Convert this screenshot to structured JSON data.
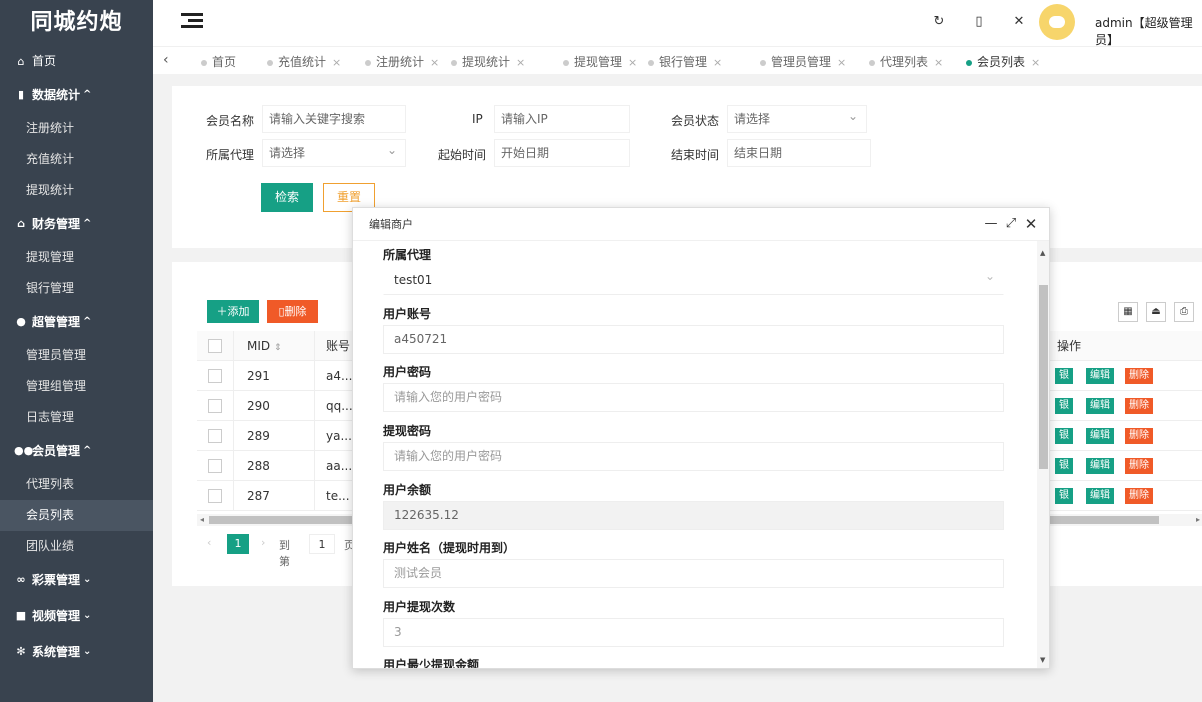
{
  "app": {
    "logo": "同城约炮"
  },
  "sidebar": {
    "home": {
      "label": "首页",
      "icon": "home-icon"
    },
    "groups": [
      {
        "label": "数据统计",
        "icon": "bar-chart-icon",
        "items": [
          "注册统计",
          "充值统计",
          "提现统计"
        ]
      },
      {
        "label": "财务管理",
        "icon": "bank-icon",
        "items": [
          "提现管理",
          "银行管理"
        ]
      },
      {
        "label": "超管管理",
        "icon": "user-icon",
        "items": [
          "管理员管理",
          "管理组管理",
          "日志管理"
        ]
      },
      {
        "label": "会员管理",
        "icon": "users-icon",
        "items": [
          "代理列表",
          "会员列表",
          "团队业绩"
        ]
      }
    ],
    "collapsed": [
      {
        "label": "彩票管理",
        "icon": "infinity-icon"
      },
      {
        "label": "视频管理",
        "icon": "video-icon"
      },
      {
        "label": "系统管理",
        "icon": "gear-icon"
      }
    ]
  },
  "header": {
    "admin_name": "admin【超级管理员】"
  },
  "tabs": [
    "首页",
    "充值统计",
    "注册统计",
    "提现统计",
    "提现管理",
    "银行管理",
    "管理员管理",
    "代理列表",
    "会员列表"
  ],
  "search": {
    "member_name_label": "会员名称",
    "member_name_placeholder": "请输入关键字搜索",
    "ip_label": "IP",
    "ip_placeholder": "请输入IP",
    "status_label": "会员状态",
    "status_value": "请选择",
    "agent_label": "所属代理",
    "agent_value": "请选择",
    "start_label": "起始时间",
    "start_placeholder": "开始日期",
    "end_label": "结束时间",
    "end_placeholder": "结束日期",
    "search_button": "检索",
    "reset_button": "重置"
  },
  "table": {
    "add_button": "添加",
    "delete_button": "删除",
    "columns": {
      "mid": "MID",
      "account": "账号",
      "ops": "操作"
    },
    "rows": [
      {
        "mid": "291",
        "account": "a4..."
      },
      {
        "mid": "290",
        "account": "qq..."
      },
      {
        "mid": "289",
        "account": "ya..."
      },
      {
        "mid": "288",
        "account": "aa..."
      },
      {
        "mid": "287",
        "account": "te..."
      }
    ],
    "op_labels": {
      "bank": "银",
      "edit": "编辑",
      "delete": "删除"
    }
  },
  "pager": {
    "current": "1",
    "goto_label": "到第",
    "goto_value": "1",
    "page_label": "页"
  },
  "modal": {
    "title": "编辑商户",
    "fields": {
      "agent_label": "所属代理",
      "agent_value": "test01",
      "account_label": "用户账号",
      "account_value": "a450721",
      "password_label": "用户密码",
      "password_placeholder": "请输入您的用户密码",
      "withdraw_pw_label": "提现密码",
      "withdraw_pw_placeholder": "请输入您的用户密码",
      "balance_label": "用户余额",
      "balance_value": "122635.12",
      "realname_label": "用户姓名（提现时用到）",
      "realname_placeholder": "测试会员",
      "withdraw_count_label": "用户提现次数",
      "withdraw_count_placeholder": "3",
      "min_withdraw_label": "用户最少提现金额"
    }
  },
  "colors": {
    "sidebar": "#39434f",
    "primary": "#16a085",
    "danger": "#f05a28",
    "warning": "#f0a030"
  }
}
